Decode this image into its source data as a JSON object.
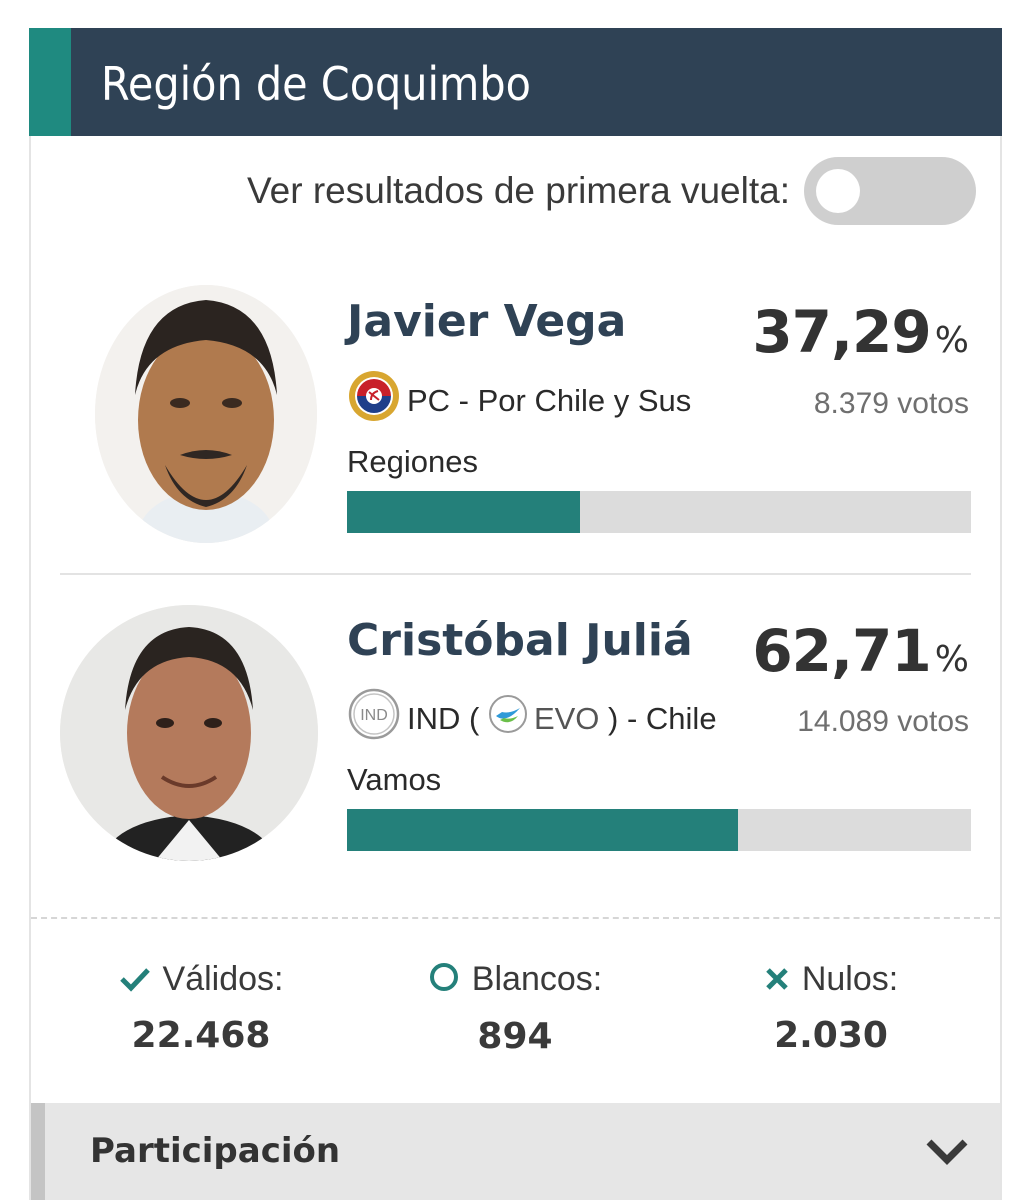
{
  "header": {
    "title": "Región de Coquimbo"
  },
  "toggle": {
    "label": "Ver resultados de primera vuelta:",
    "state": "off"
  },
  "candidates": [
    {
      "name": "Javier Vega",
      "party_text": "PC - Por Chile y Sus Regiones",
      "party_icon": "pc-party-icon",
      "percent_text": "37,29",
      "percent_sign": "%",
      "votes_text": "8.379 votos",
      "share": 0.3729
    },
    {
      "name": "Cristóbal Juliá",
      "party_prefix": "IND (",
      "party_ind_icon": "ind-badge-icon",
      "party_evo_icon": "evo-party-icon",
      "party_evo": "EVO",
      "party_suffix": ") - Chile Vamos",
      "percent_text": "62,71",
      "percent_sign": "%",
      "votes_text": "14.089 votos",
      "share": 0.6271
    }
  ],
  "stats": {
    "validos": {
      "label": "Válidos:",
      "value": "22.468",
      "icon": "check-icon"
    },
    "blancos": {
      "label": "Blancos:",
      "value": "894",
      "icon": "circle-icon"
    },
    "nulos": {
      "label": "Nulos:",
      "value": "2.030",
      "icon": "x-icon"
    }
  },
  "participacion": {
    "label": "Participación",
    "icon": "chevron-down-icon"
  },
  "colors": {
    "header_bg": "#2f4255",
    "accent": "#1f8a80",
    "bar_fill": "#24807a",
    "bar_bg": "#dcdcdc"
  }
}
